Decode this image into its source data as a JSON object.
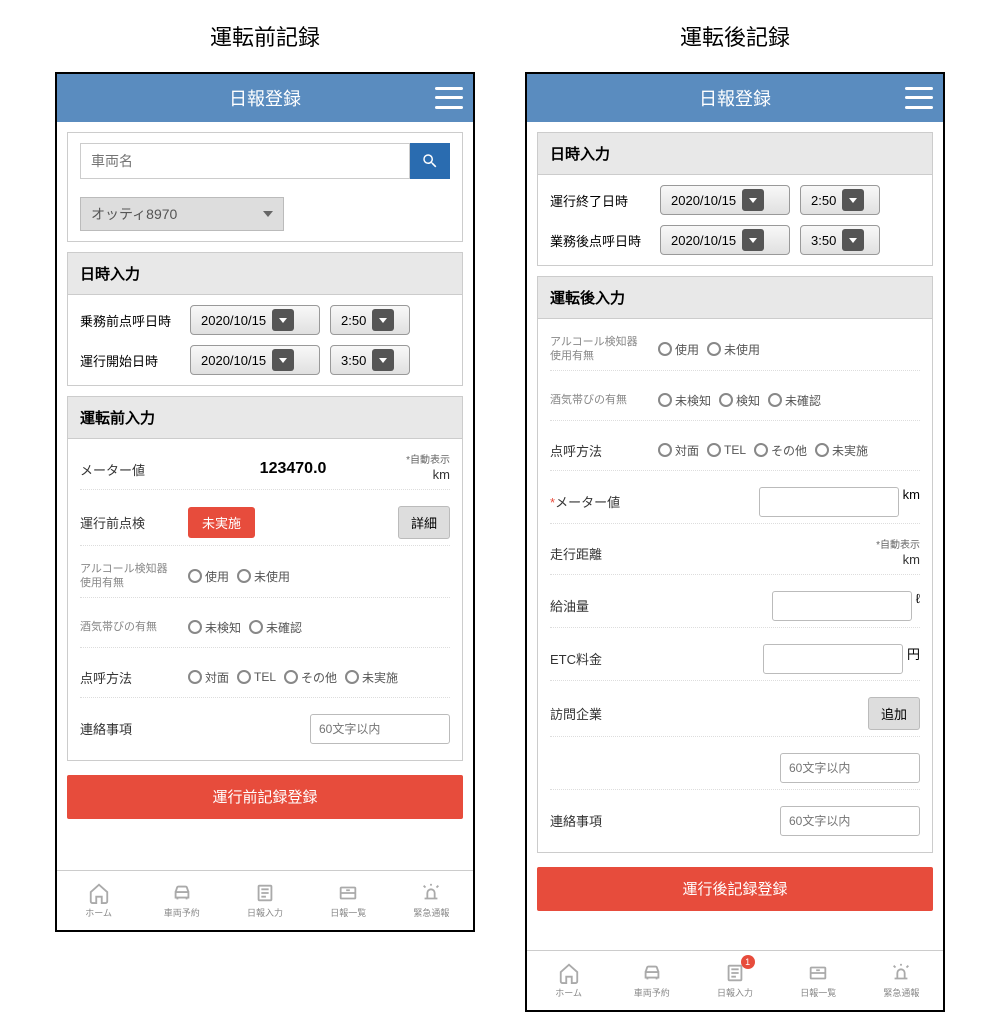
{
  "left": {
    "title": "運転前記録",
    "header": "日報登録",
    "search": {
      "placeholder": "車両名",
      "vehicle": "オッティ8970"
    },
    "datetime": {
      "title": "日時入力",
      "rows": [
        {
          "label": "乗務前点呼日時",
          "date": "2020/10/15",
          "time": "2:50"
        },
        {
          "label": "運行開始日時",
          "date": "2020/10/15",
          "time": "3:50"
        }
      ]
    },
    "pre": {
      "title": "運転前入力",
      "meter": {
        "label": "メーター値",
        "value": "123470.0",
        "note": "*自動表示",
        "unit": "km"
      },
      "check": {
        "label": "運行前点検",
        "status": "未実施",
        "detail": "詳細"
      },
      "alcohol": {
        "label": "アルコール検知器\n使用有無",
        "opts": [
          "使用",
          "未使用"
        ]
      },
      "sake": {
        "label": "酒気帯びの有無",
        "opts": [
          "未検知",
          "未確認"
        ]
      },
      "method": {
        "label": "点呼方法",
        "opts": [
          "対面",
          "TEL",
          "その他",
          "未実施"
        ]
      },
      "contact": {
        "label": "連絡事項",
        "placeholder": "60文字以内"
      }
    },
    "submit": "運行前記録登録"
  },
  "right": {
    "title": "運転後記録",
    "header": "日報登録",
    "datetime": {
      "title": "日時入力",
      "rows": [
        {
          "label": "運行終了日時",
          "date": "2020/10/15",
          "time": "2:50"
        },
        {
          "label": "業務後点呼日時",
          "date": "2020/10/15",
          "time": "3:50"
        }
      ]
    },
    "post": {
      "title": "運転後入力",
      "alcohol": {
        "label": "アルコール検知器\n使用有無",
        "opts": [
          "使用",
          "未使用"
        ]
      },
      "sake": {
        "label": "酒気帯びの有無",
        "opts": [
          "未検知",
          "検知",
          "未確認"
        ]
      },
      "method": {
        "label": "点呼方法",
        "opts": [
          "対面",
          "TEL",
          "その他",
          "未実施"
        ]
      },
      "meter": {
        "label": "メーター値",
        "unit": "km",
        "req": "*"
      },
      "distance": {
        "label": "走行距離",
        "note": "*自動表示",
        "unit": "km"
      },
      "fuel": {
        "label": "給油量",
        "unit": "ℓ"
      },
      "etc": {
        "label": "ETC料金",
        "unit": "円"
      },
      "visit": {
        "label": "訪問企業",
        "btn": "追加",
        "placeholder": "60文字以内"
      },
      "contact": {
        "label": "連絡事項",
        "placeholder": "60文字以内"
      }
    },
    "submit": "運行後記録登録",
    "badge": "1"
  },
  "tabs": [
    "ホーム",
    "車両予約",
    "日報入力",
    "日報一覧",
    "緊急通報"
  ]
}
